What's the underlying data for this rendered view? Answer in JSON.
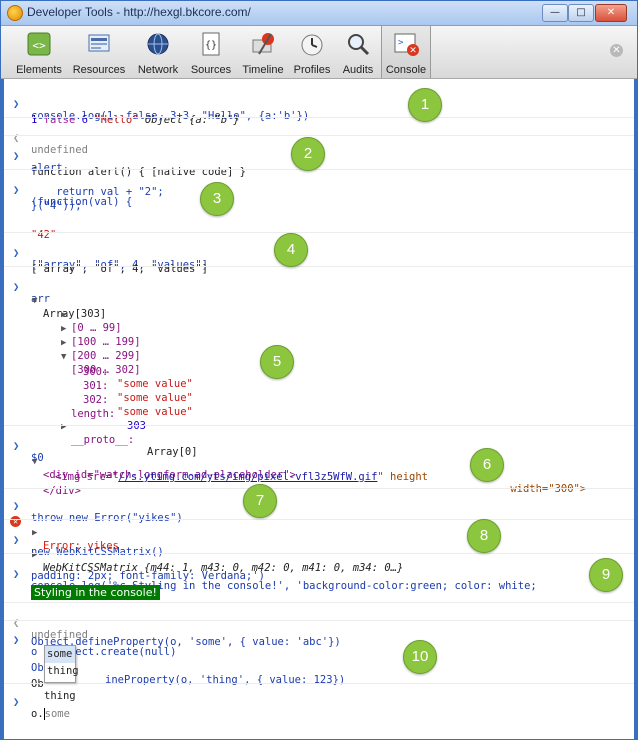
{
  "window": {
    "title": "Developer Tools - http://hexgl.bkcore.com/",
    "min_glyph": "—",
    "max_glyph": "□",
    "close_glyph": "✕"
  },
  "toolbar": {
    "tabs": [
      {
        "label": "Elements",
        "icon": "elements-icon"
      },
      {
        "label": "Resources",
        "icon": "resources-icon"
      },
      {
        "label": "Network",
        "icon": "network-icon"
      },
      {
        "label": "Sources",
        "icon": "sources-icon"
      },
      {
        "label": "Timeline",
        "icon": "timeline-icon"
      },
      {
        "label": "Profiles",
        "icon": "profiles-icon"
      },
      {
        "label": "Audits",
        "icon": "audits-icon"
      },
      {
        "label": "Console",
        "icon": "console-icon"
      }
    ],
    "active_tab": "Console",
    "close_glyph": "✕"
  },
  "console": {
    "l1_cmd": "console.log(1, false, 3+3, \"Hello\", {a:'b'})",
    "l1_out_num1": "1",
    "l1_out_false": "false",
    "l1_out_num2": "6",
    "l1_out_str": "\"Hello\"",
    "l1_out_obj": "Object",
    "l1_out_objval": "{a: \"b\"}",
    "l2_undef": "undefined",
    "l3_cmd": "alert",
    "l3_out": "function alert() { [native code] }",
    "l4_cmd_a": "(function(val) {",
    "l4_cmd_b": "    return val + \"2\";",
    "l4_cmd_c": "}(\"4\"));",
    "l4_out": "\"42\"",
    "l5_cmd": "[\"array\", \"of\", 4, \"values\"]",
    "l5_out": "[\"array\", \"of\", 4, \"values\"]",
    "l6_cmd": "arr",
    "l6_array": "Array[303]",
    "l6_r1": "[0 … 99]",
    "l6_r2": "[100 … 199]",
    "l6_r3": "[200 … 299]",
    "l6_r4": "[300 … 302]",
    "l6_k300": "300:",
    "l6_v300": "\"some value\"",
    "l6_k301": "301:",
    "l6_v301": "\"some value\"",
    "l6_k302": "302:",
    "l6_v302": "\"some value\"",
    "l6_len_k": "length:",
    "l6_len_v": "303",
    "l6_proto_k": "__proto__:",
    "l6_proto_v": "Array[0]",
    "l7_cmd": "$0",
    "l7_div_open": "<div id=\"watch-longform-ad-placeholder\">",
    "l7_img_a": "<img src=\"",
    "l7_img_src": "//s.ytimg.com/yts/img/pixel-vfl3z5WfW.gif",
    "l7_img_b": "\" height",
    "l7_img_c": " width=\"300\">",
    "l7_div_close": "</div>",
    "l8_cmd": "throw new Error(\"yikes\")",
    "l8_err": "Error: yikes",
    "l9_cmd": "new WebKitCSSMatrix()",
    "l9_out": "WebKitCSSMatrix {m44: 1, m43: 0, m42: 0, m41: 0, m34: 0…}",
    "l10_cmd_a": "console.log('%c Styling in the console!', 'background-color:green; color: white;",
    "l10_cmd_b": "padding: 2px; font-family: Verdana;')",
    "l10_styled": "Styling in the console!",
    "l10_undef": "undefined",
    "l11_cmd_a": "o = Object.create(null)",
    "l11_cmd_b": "Object.defineProperty(o, 'some', { value: 'abc'})",
    "l11_cmd_c_pre": "Ob",
    "l11_cmd_c_post": "ineProperty(o, 'thing', { value: 123})",
    "l11_cmd_d_pre": "Ob",
    "l11_cmd_d_post": "thing",
    "l12_typed": "o.",
    "l12_hint": "some"
  },
  "autocomplete": {
    "options": [
      "some",
      "thing"
    ]
  },
  "badges": [
    "1",
    "2",
    "3",
    "4",
    "5",
    "6",
    "7",
    "8",
    "9",
    "10"
  ],
  "colors": {
    "badge": "#8cc63f",
    "prompt": "#2b61c8",
    "string": "#c41a16",
    "number": "#1c00cf",
    "error": "#d8220d",
    "styled_bg": "#007a00"
  }
}
